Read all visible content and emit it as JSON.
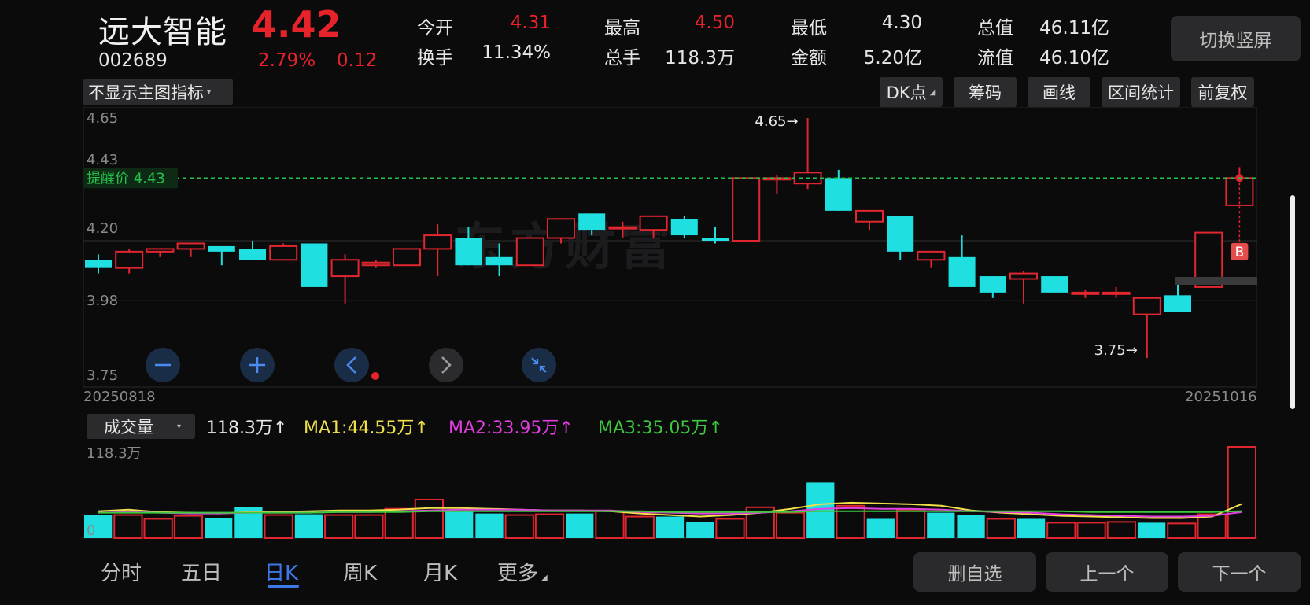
{
  "header": {
    "name": "远大智能",
    "price": "4.42",
    "code": "002689",
    "change_pct": "2.79%",
    "change_amt": "0.12",
    "switch_label": "切换竖屏"
  },
  "quotes": [
    {
      "label": "今开",
      "value": "4.31",
      "color": "red"
    },
    {
      "label": "最高",
      "value": "4.50",
      "color": "red"
    },
    {
      "label": "最低",
      "value": "4.30",
      "color": "white"
    },
    {
      "label": "总值",
      "value": "46.11亿",
      "color": "white"
    },
    {
      "label": "换手",
      "value": "11.34%",
      "color": "white"
    },
    {
      "label": "总手",
      "value": "118.3万",
      "color": "white"
    },
    {
      "label": "金额",
      "value": "5.20亿",
      "color": "white"
    },
    {
      "label": "流值",
      "value": "46.10亿",
      "color": "white"
    }
  ],
  "chart_controls": {
    "indicator_select": "不显示主图指标",
    "dk_label": "DK点",
    "chips_label": "筹码",
    "draw_label": "画线",
    "interval_label": "区间统计",
    "adjust_label": "前复权"
  },
  "chart_data": {
    "type": "candlestick",
    "y_ticks": [
      "4.65",
      "4.43",
      "4.20",
      "3.98",
      "3.75"
    ],
    "ylim": [
      3.75,
      4.65
    ],
    "start_date": "20250818",
    "end_date": "20251016",
    "alert_label": "提醒价 4.43",
    "alert_price": 4.43,
    "high_marker": "4.65→",
    "low_marker": "3.75→",
    "watermark": "东方财富",
    "buy_marker": "B",
    "candles": [
      [
        4.13,
        4.1,
        4.15,
        4.08
      ],
      [
        4.1,
        4.16,
        4.17,
        4.08
      ],
      [
        4.16,
        4.17,
        4.17,
        4.14
      ],
      [
        4.17,
        4.19,
        4.19,
        4.14
      ],
      [
        4.18,
        4.16,
        4.18,
        4.11
      ],
      [
        4.17,
        4.13,
        4.2,
        4.13
      ],
      [
        4.13,
        4.18,
        4.19,
        4.13
      ],
      [
        4.19,
        4.03,
        4.19,
        4.03
      ],
      [
        4.07,
        4.13,
        4.15,
        3.97
      ],
      [
        4.11,
        4.12,
        4.13,
        4.1
      ],
      [
        4.11,
        4.17,
        4.17,
        4.11
      ],
      [
        4.17,
        4.22,
        4.26,
        4.07
      ],
      [
        4.21,
        4.11,
        4.25,
        4.11
      ],
      [
        4.14,
        4.11,
        4.19,
        4.07
      ],
      [
        4.11,
        4.21,
        4.21,
        4.12
      ],
      [
        4.21,
        4.28,
        4.28,
        4.19
      ],
      [
        4.3,
        4.24,
        4.3,
        4.22
      ],
      [
        4.25,
        4.25,
        4.27,
        4.21
      ],
      [
        4.24,
        4.29,
        4.29,
        4.21
      ],
      [
        4.28,
        4.22,
        4.29,
        4.21
      ],
      [
        4.21,
        4.2,
        4.25,
        4.19
      ],
      [
        4.2,
        4.43,
        4.43,
        4.2
      ],
      [
        4.43,
        4.43,
        4.44,
        4.37
      ],
      [
        4.41,
        4.45,
        4.65,
        4.39
      ],
      [
        4.43,
        4.31,
        4.46,
        4.31
      ],
      [
        4.27,
        4.31,
        4.28,
        4.24
      ],
      [
        4.29,
        4.16,
        4.29,
        4.13
      ],
      [
        4.13,
        4.16,
        4.16,
        4.1
      ],
      [
        4.14,
        4.03,
        4.22,
        4.03
      ],
      [
        4.07,
        4.01,
        4.05,
        3.99
      ],
      [
        4.06,
        4.08,
        4.09,
        3.97
      ],
      [
        4.07,
        4.01,
        4.07,
        4.01
      ],
      [
        4.01,
        4.01,
        4.02,
        3.99
      ],
      [
        4.01,
        4.01,
        4.03,
        3.99
      ],
      [
        3.93,
        3.99,
        3.99,
        3.77
      ],
      [
        4.0,
        3.94,
        4.04,
        3.94
      ],
      [
        4.03,
        4.23,
        4.23,
        4.03
      ],
      [
        4.33,
        4.43,
        4.47,
        4.33
      ]
    ],
    "volume": {
      "select_label": "成交量",
      "current_label": "118.3万",
      "ma1_label": "MA1:44.55万",
      "ma2_label": "MA2:33.95万",
      "ma3_label": "MA3:35.05万",
      "y_max_label": "118.3万",
      "y_min_label": "0",
      "arrow": "↑",
      "values": [
        30,
        30,
        25,
        29,
        26,
        40,
        30,
        31,
        30,
        30,
        38,
        50,
        35,
        32,
        30,
        31,
        32,
        35,
        28,
        28,
        21,
        25,
        40,
        33,
        72,
        42,
        25,
        37,
        33,
        30,
        25,
        25,
        20,
        20,
        21,
        20,
        19,
        31,
        118.3
      ],
      "ma1": [
        35,
        37,
        34,
        33,
        32,
        34,
        34,
        35,
        36,
        36,
        37,
        39,
        39,
        38,
        37,
        36,
        36,
        35,
        32,
        30,
        28,
        30,
        33,
        38,
        44,
        46,
        45,
        44,
        42,
        36,
        33,
        31,
        29,
        28,
        27,
        26,
        26,
        28,
        44.55
      ],
      "ma2": [
        33,
        34,
        33,
        32,
        32,
        33,
        33,
        33,
        34,
        34,
        35,
        36,
        37,
        37,
        37,
        36,
        36,
        36,
        34,
        33,
        32,
        32,
        33,
        35,
        38,
        39,
        38,
        38,
        37,
        35,
        34,
        33,
        31,
        30,
        29,
        28,
        28,
        29,
        33.95
      ],
      "ma3": [
        33,
        33,
        33,
        33,
        33,
        33,
        33,
        33,
        34,
        34,
        34,
        35,
        35,
        35,
        35,
        35,
        35,
        35,
        35,
        34,
        34,
        34,
        34,
        34,
        35,
        35,
        35,
        35,
        35,
        35,
        35,
        35,
        35,
        34,
        34,
        34,
        34,
        34,
        35.05
      ]
    }
  },
  "colors": {
    "up": "#e0262f",
    "down": "#1fdfe0",
    "ma1": "#f0e04a",
    "ma2": "#e23ee2",
    "ma3": "#3ec83e",
    "alert": "#24c24a"
  },
  "icons": [
    "zoom-out-icon",
    "zoom-in-icon",
    "pan-left-icon",
    "pan-right-icon",
    "collapse-icon"
  ],
  "bottom": {
    "tabs": [
      "分时",
      "五日",
      "日K",
      "周K",
      "月K",
      "更多"
    ],
    "active_tab": "日K",
    "remove_label": "删自选",
    "prev_label": "上一个",
    "next_label": "下一个"
  }
}
